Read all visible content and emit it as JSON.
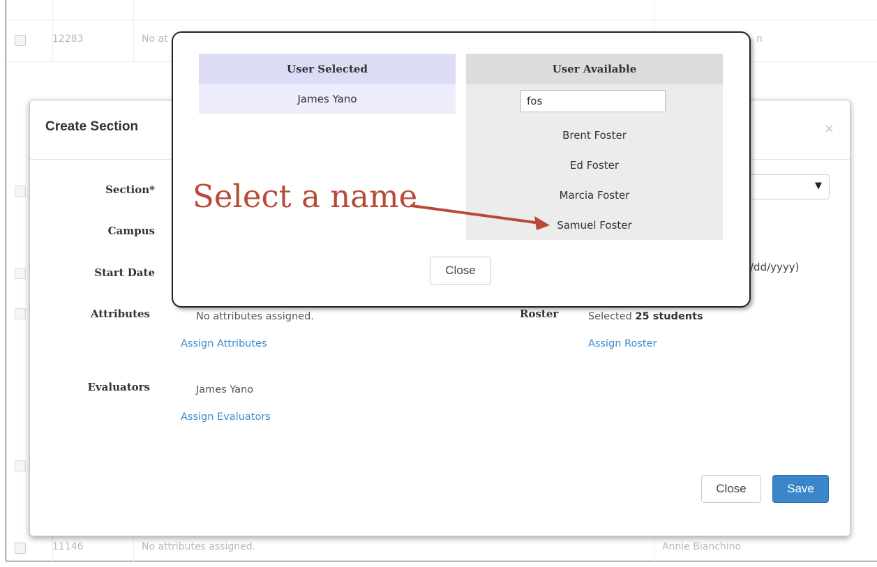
{
  "background": {
    "rows": [
      {
        "id": "12283",
        "text": "No at",
        "right": "n"
      },
      {
        "id": "11146",
        "text": "No attributes assigned.",
        "right": "Annie Bianchino"
      }
    ]
  },
  "create_modal": {
    "title": "Create Section",
    "close_x": "×",
    "labels": {
      "section": "Section*",
      "campus": "Campus",
      "start_date": "Start Date",
      "attributes": "Attributes",
      "evaluators": "Evaluators",
      "roster": "Roster"
    },
    "date_hint": "/dd/yyyy)",
    "select_caret": "▼",
    "attributes_text": "No attributes assigned.",
    "assign_attributes": "Assign Attributes",
    "evaluator_name": "James Yano",
    "assign_evaluators": "Assign Evaluators",
    "roster_prefix": "Selected ",
    "roster_count": "25 students",
    "assign_roster": "Assign Roster",
    "close_button": "Close",
    "save_button": "Save"
  },
  "picker": {
    "selected_header": "User Selected",
    "selected_users": [
      "James Yano"
    ],
    "available_header": "User Available",
    "search_value": "fos",
    "available_users": [
      "Brent Foster",
      "Ed Foster",
      "Marcia Foster",
      "Samuel Foster"
    ],
    "close_button": "Close"
  },
  "annotation": {
    "text": "Select a name",
    "color": "#b84a36"
  }
}
